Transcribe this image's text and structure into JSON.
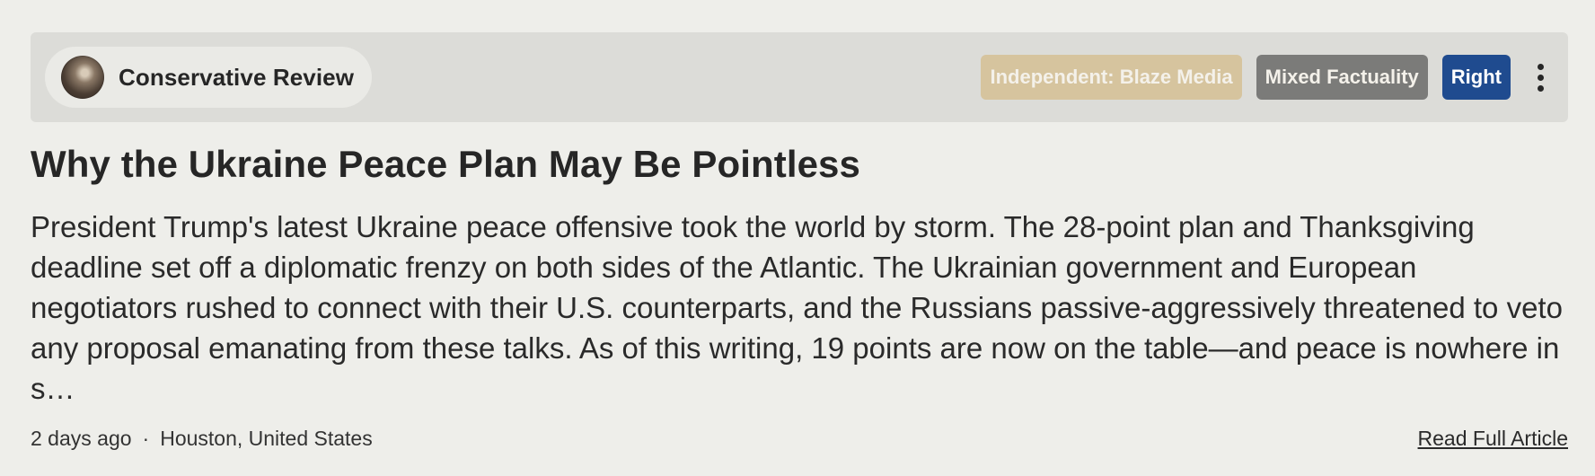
{
  "source": {
    "name": "Conservative Review"
  },
  "badges": {
    "ownership": "Independent: Blaze Media",
    "factuality": "Mixed Factuality",
    "bias": "Right"
  },
  "article": {
    "headline": "Why the Ukraine Peace Plan May Be Pointless",
    "summary": "President Trump's latest Ukraine peace offensive took the world by storm. The 28-point plan and Thanksgiving deadline set off a diplomatic frenzy on both sides of the Atlantic. The Ukrainian government and European negotiators rushed to connect with their U.S. counterparts, and the Russians passive-aggressively threatened to veto any proposal emanating from these talks. As of this writing, 19 points are now on the table—and peace is nowhere in s…",
    "time_ago": "2 days ago",
    "separator": "·",
    "location": "Houston, United States",
    "read_more": "Read Full Article"
  },
  "colors": {
    "ownership_badge": "#d6c49e",
    "factuality_badge": "#7b7b79",
    "bias_badge": "#1f4b8f"
  },
  "icons": {
    "more": "more-vertical-icon",
    "avatar": "source-avatar"
  }
}
